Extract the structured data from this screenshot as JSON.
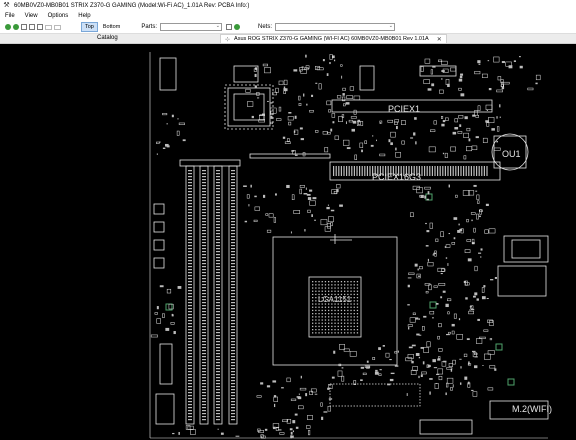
{
  "window": {
    "title": "60MB0VZ0-MB0B01 STRIX Z370-G GAMING (Model:Wi-Fi AC)_1.01A Rev: PCBA Info:)"
  },
  "menu": [
    "File",
    "View",
    "Options",
    "Help"
  ],
  "toolbar": {
    "top_label": "Top",
    "bottom_label": "Bottom",
    "parts_label": "Parts:",
    "parts_value": "",
    "nets_label": "Nets:",
    "nets_value": ""
  },
  "panels": {
    "catalog_label": "Catalog",
    "document_tab": "Asus ROG STRIX Z370-G GAMING (WI-FI AC) 60MB0VZ0-MB0B01 Rev 1.01A"
  },
  "board": {
    "labels": {
      "pciex1": "PCIEX1",
      "pciex16": "PCIEX16G3",
      "cpu": "LGA1151",
      "ou1": "OU1",
      "m2": "M.2(WIFI)"
    },
    "colors": {
      "background": "#000000",
      "silkscreen": "#e6e6e6",
      "pad": "#bdbdbd",
      "accent": "#4fa36b"
    }
  }
}
